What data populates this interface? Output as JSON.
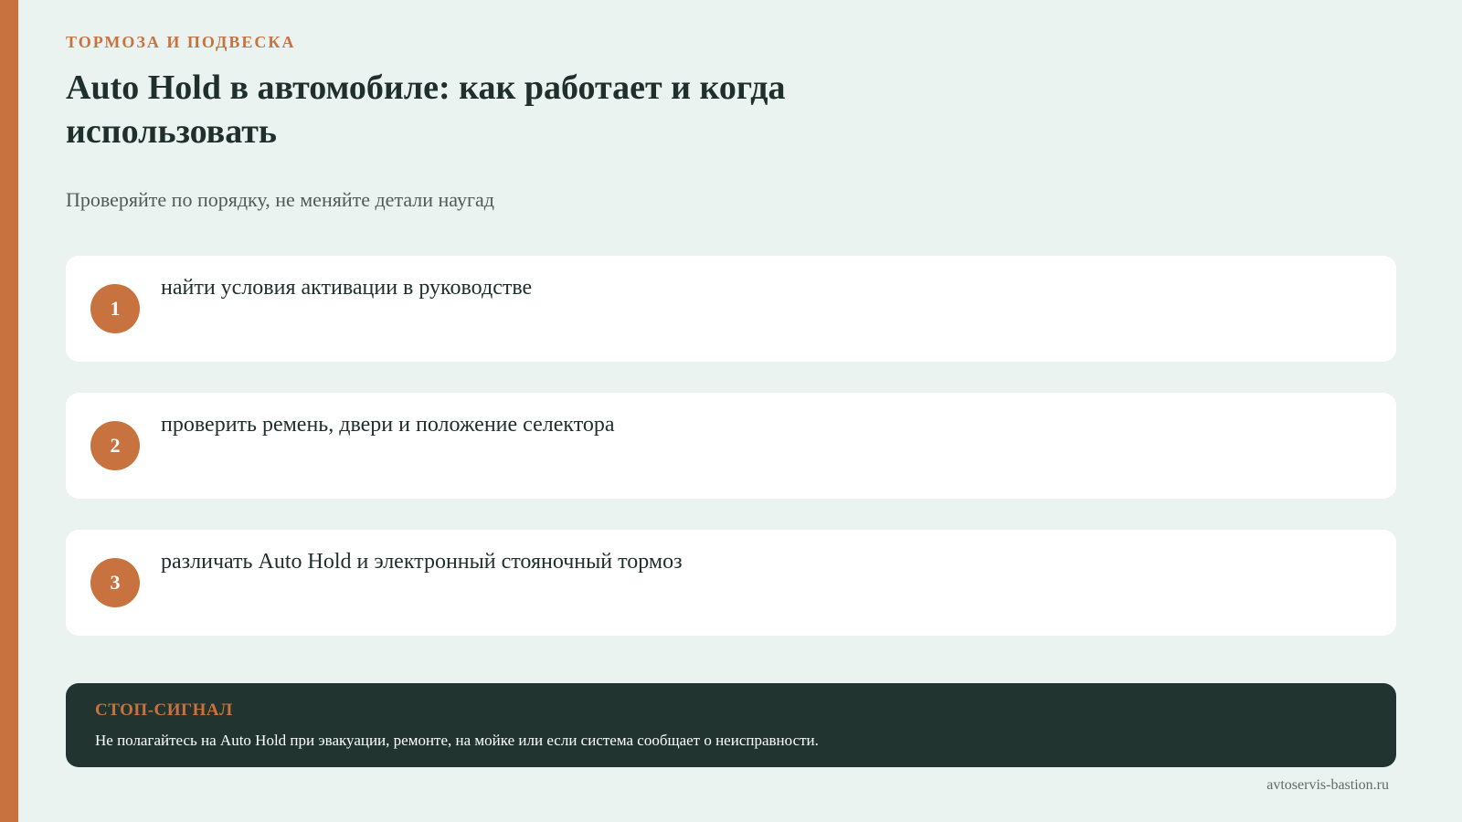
{
  "header": {
    "kicker": "ТОРМОЗА И ПОДВЕСКА",
    "title": "Auto Hold в автомобиле: как работает и когда использовать",
    "subtitle": "Проверяйте по порядку, не меняйте детали наугад"
  },
  "steps": [
    {
      "number": "1",
      "text": "найти условия активации в руководстве"
    },
    {
      "number": "2",
      "text": "проверить ремень, двери и положение селектора"
    },
    {
      "number": "3",
      "text": "различать Auto Hold и электронный стояночный тормоз"
    }
  ],
  "alert": {
    "title": "СТОП-СИГНАЛ",
    "text": "Не полагайтесь на Auto Hold при эвакуации, ремонте, на мойке или если система сообщает о неисправности."
  },
  "footer": {
    "site": "avtoservis-bastion.ru"
  },
  "colors": {
    "accent": "#C8733F",
    "background": "#EAF3EF",
    "card": "#FFFFFF",
    "dark_panel": "#213430",
    "text": "#1F2F2B"
  }
}
